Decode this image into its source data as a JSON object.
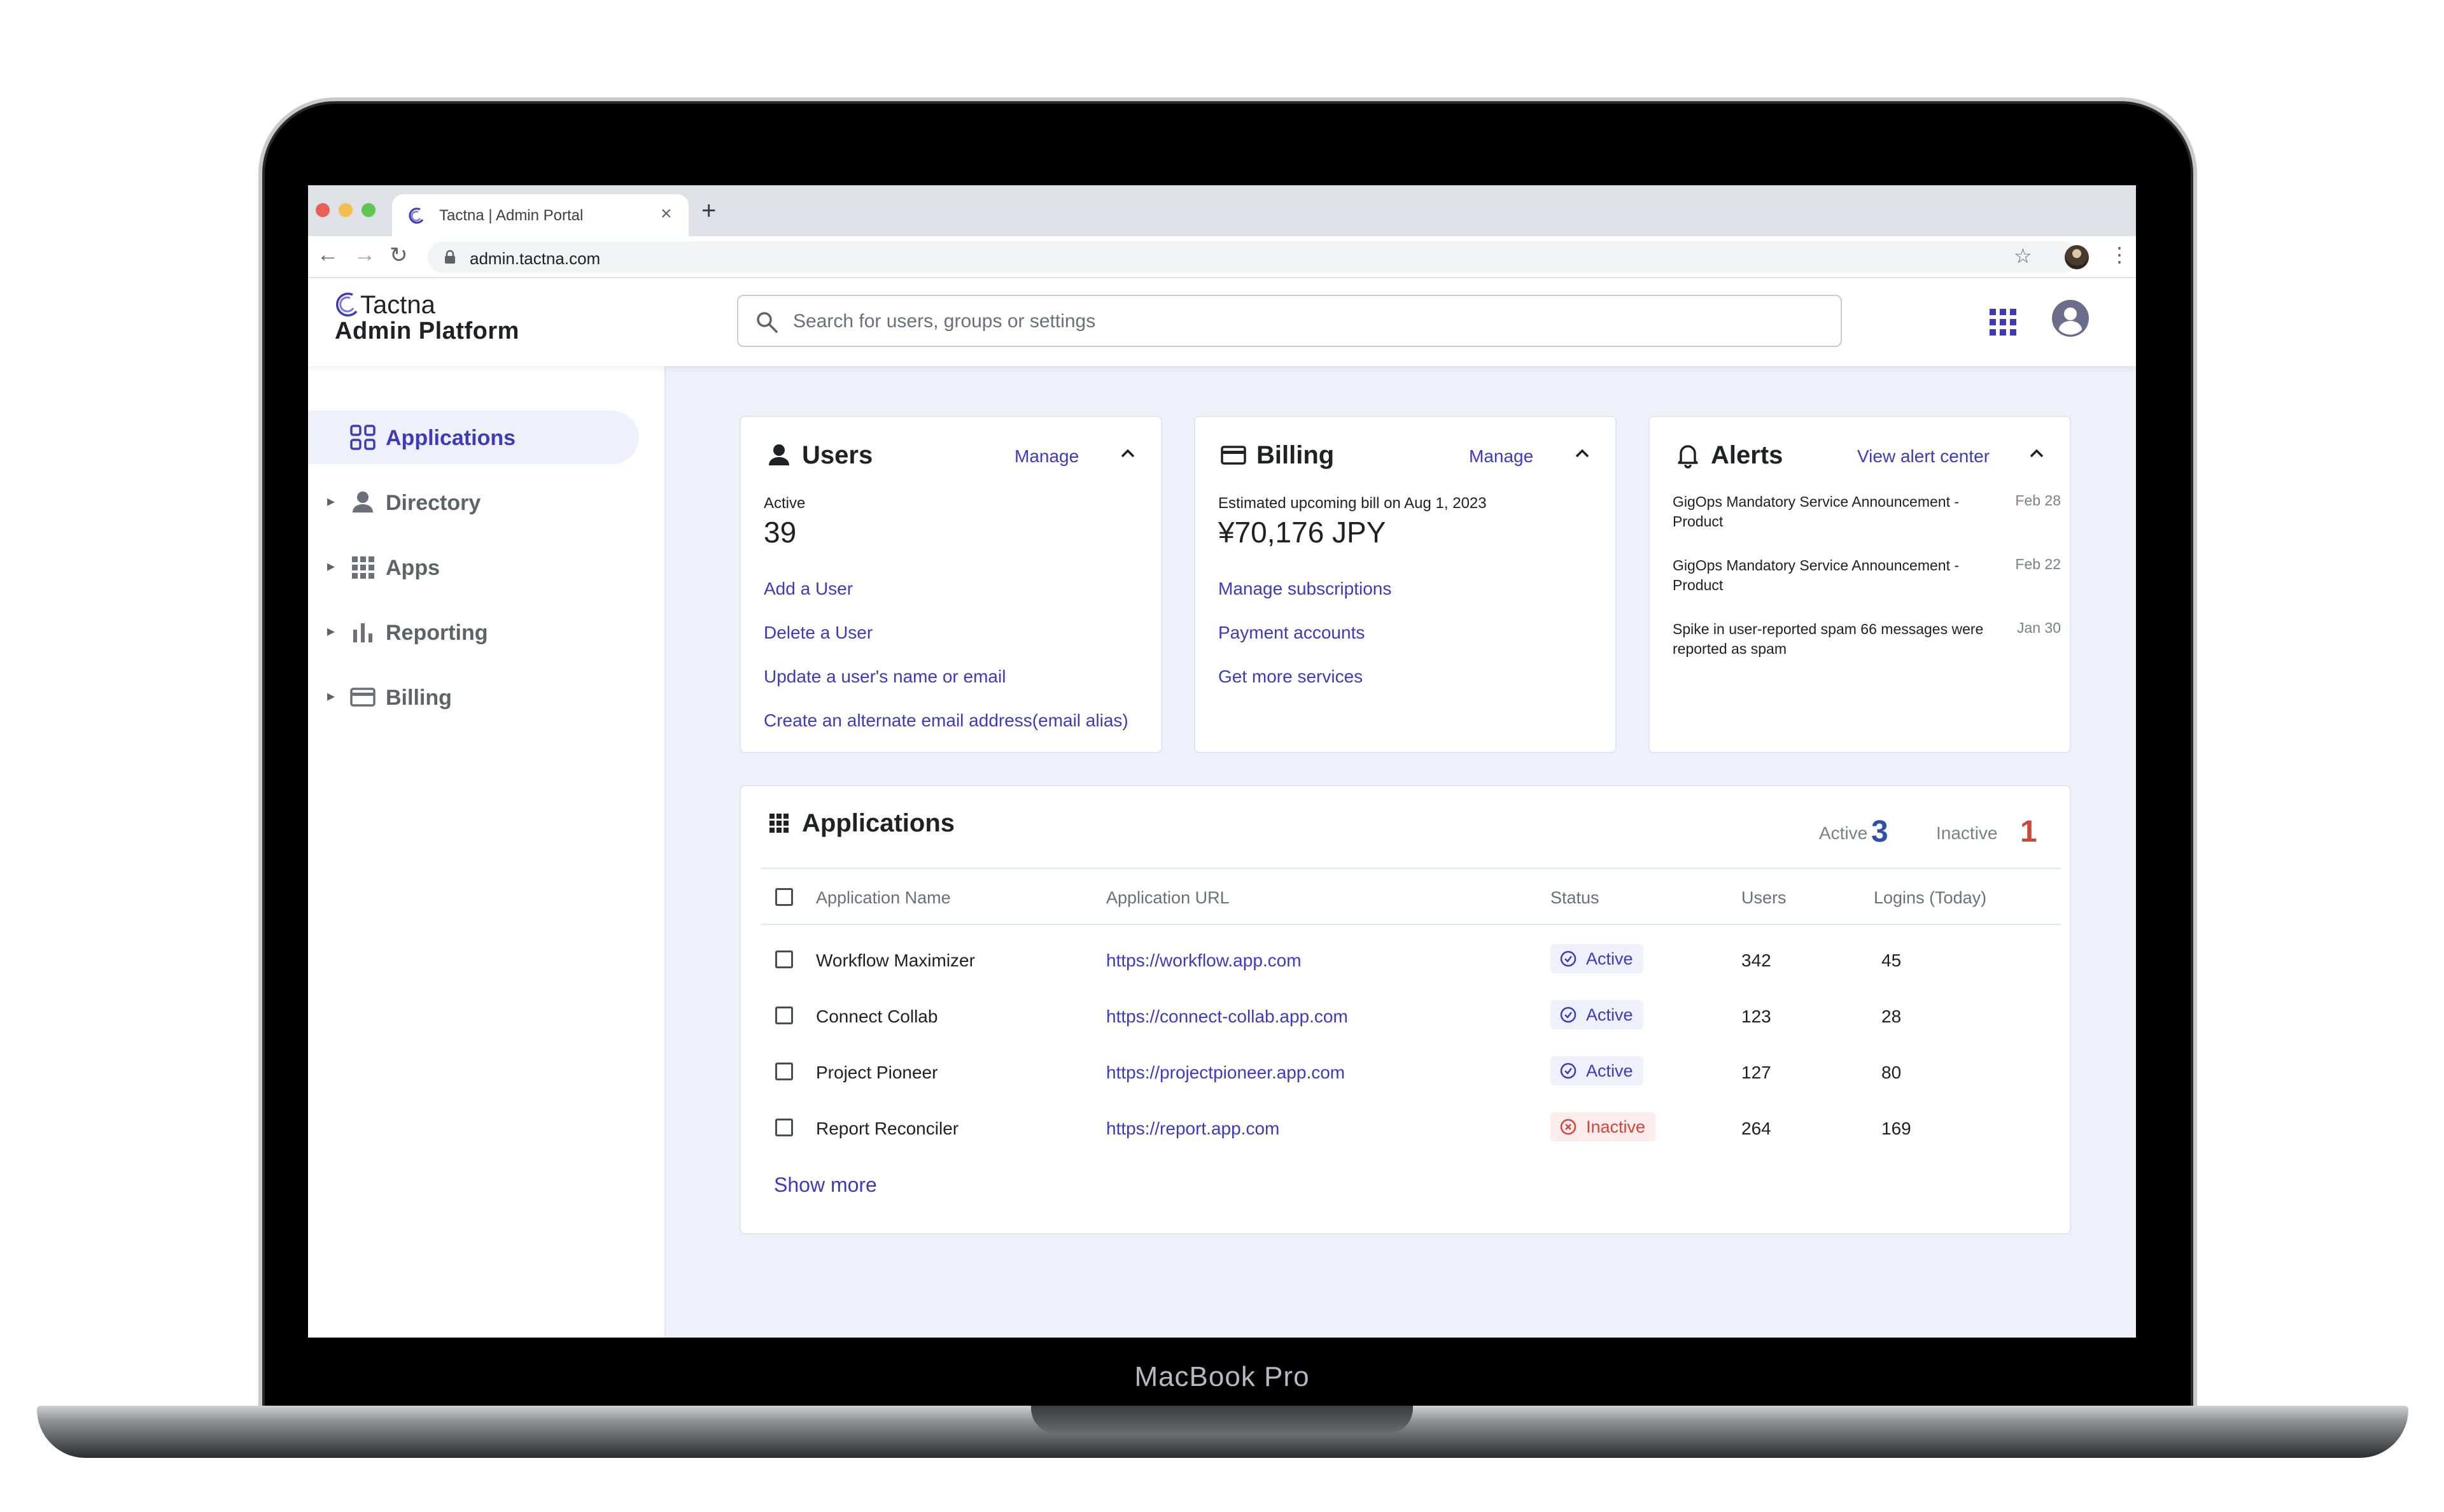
{
  "device": {
    "brand": "MacBook Pro"
  },
  "browser": {
    "tab_title": "Tactna | Admin Portal",
    "tab_close": "×",
    "new_tab": "+",
    "url": "admin.tactna.com"
  },
  "header": {
    "logo_line1": "Tactna",
    "logo_line2": "Admin Platform",
    "search_placeholder": "Search for users, groups or settings"
  },
  "sidebar": {
    "items": [
      {
        "label": "Applications",
        "icon": "apps-outline-icon",
        "active": true
      },
      {
        "label": "Directory",
        "icon": "person-icon",
        "active": false
      },
      {
        "label": "Apps",
        "icon": "grid-icon",
        "active": false
      },
      {
        "label": "Reporting",
        "icon": "bar-chart-icon",
        "active": false
      },
      {
        "label": "Billing",
        "icon": "credit-card-icon",
        "active": false
      }
    ]
  },
  "users_card": {
    "title": "Users",
    "action": "Manage",
    "stat_label": "Active",
    "stat_value": "39",
    "links": [
      "Add a User",
      "Delete a User",
      "Update a user's name or email",
      "Create an alternate email address(email alias)"
    ]
  },
  "billing_card": {
    "title": "Billing",
    "action": "Manage",
    "stat_label": "Estimated upcoming bill on Aug 1, 2023",
    "stat_value": "¥70,176 JPY",
    "links": [
      "Manage subscriptions",
      "Payment accounts",
      "Get more services"
    ]
  },
  "alerts_card": {
    "title": "Alerts",
    "action": "View alert center",
    "items": [
      {
        "text": "GigOps Mandatory Service Announcement - Product",
        "date": "Feb 28"
      },
      {
        "text": "GigOps Mandatory Service Announcement - Product",
        "date": "Feb 22"
      },
      {
        "text": "Spike in user-reported spam 66 messages were reported as spam",
        "date": "Jan 30"
      }
    ]
  },
  "applications_card": {
    "title": "Applications",
    "active_label": "Active",
    "active_count": "3",
    "inactive_label": "Inactive",
    "inactive_count": "1",
    "columns": [
      "Application Name",
      "Application URL",
      "Status",
      "Users",
      "Logins (Today)"
    ],
    "rows": [
      {
        "name": "Workflow Maximizer",
        "url": "https://workflow.app.com",
        "status": "Active",
        "users": "342",
        "logins": "45"
      },
      {
        "name": "Connect Collab",
        "url": "https://connect-collab.app.com",
        "status": "Active",
        "users": "123",
        "logins": "28"
      },
      {
        "name": "Project Pioneer",
        "url": "https://projectpioneer.app.com",
        "status": "Active",
        "users": "127",
        "logins": "80"
      },
      {
        "name": "Report Reconciler",
        "url": "https://report.app.com",
        "status": "Inactive",
        "users": "264",
        "logins": "169"
      }
    ],
    "show_more": "Show more"
  },
  "colors": {
    "accent": "#3f3bb8",
    "active_count": "#2f4fa8",
    "inactive_count": "#d2453b"
  }
}
